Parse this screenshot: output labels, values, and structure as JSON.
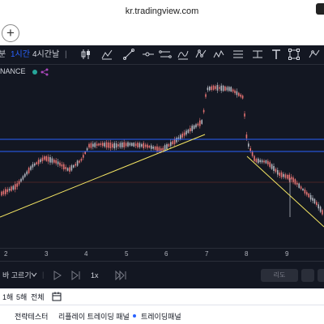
{
  "browser": {
    "url": "kr.tradingview.com",
    "new_tab_symbol": "+"
  },
  "toolbar": {
    "items": [
      {
        "label": "분"
      },
      {
        "label": "1시간",
        "active": true
      },
      {
        "label": "4시간"
      },
      {
        "label": "날"
      }
    ],
    "icons": [
      "candles-icon",
      "indicators-icon",
      "trend-line-icon",
      "horizontal-ray-icon",
      "parallel-channel-icon",
      "pitchfork-icon",
      "brush-icon",
      "pattern-icon",
      "fib-icon",
      "projection-icon",
      "measure-icon",
      "text-icon",
      "shape-icon",
      "more-icon"
    ]
  },
  "chart": {
    "symbol_label": "NANCE",
    "time_ticks": [
      "2",
      "3",
      "4",
      "5",
      "6",
      "7",
      "8",
      "9"
    ],
    "colors": {
      "bg": "#131722",
      "up": "#b2b5be",
      "down": "#e57373",
      "blue_line": "#2962ff",
      "trend_line": "#f5e663"
    }
  },
  "replay": {
    "select_bar": "바 고르기",
    "speed": "1x",
    "pill": "리도"
  },
  "range": {
    "items": [
      "1해",
      "5해",
      "전체"
    ]
  },
  "bottom_tabs": {
    "items": [
      "전략테스터",
      "리플레이 트레이딩 패널",
      "트레이딩패널"
    ]
  }
}
